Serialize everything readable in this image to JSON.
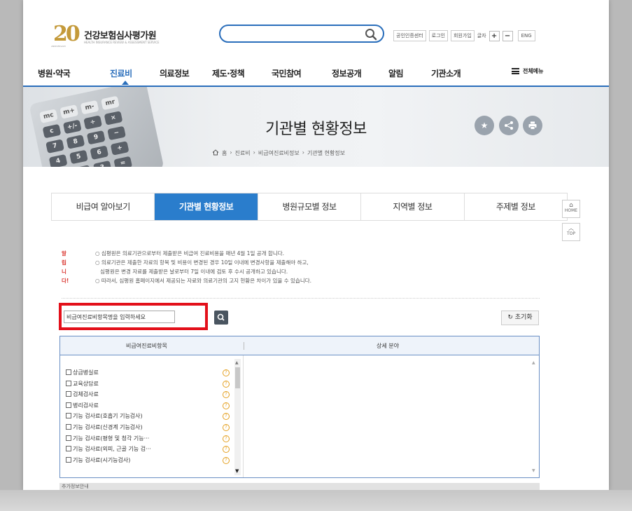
{
  "header": {
    "logo_number": "20",
    "logo_title": "건강보험심사평가원",
    "logo_subtitle": "HEALTH INSURANCE REVIEW & ASSESSMENT SERVICE",
    "logo_small": "ANNIVERSARY",
    "search_placeholder": "",
    "util": {
      "cert_center": "공인인증센터",
      "login": "로그인",
      "join": "회원가입",
      "font_label": "글자",
      "font_plus": "+",
      "font_minus": "−",
      "eng": "ENG"
    }
  },
  "gnb": {
    "items": [
      "병원·약국",
      "진료비",
      "의료정보",
      "제도·정책",
      "국민참여",
      "정보공개",
      "알림",
      "기관소개"
    ],
    "active_index": 1,
    "all_menu": "전체메뉴"
  },
  "banner": {
    "title": "기관별 현황정보",
    "breadcrumb": [
      "홈",
      "진료비",
      "비급여진료비정보",
      "기관별 현황정보"
    ],
    "keys": [
      "mc",
      "m+",
      "m-",
      "mr",
      "c",
      "+/-",
      "÷",
      "×",
      "7",
      "8",
      "9",
      "−",
      "4",
      "5",
      "6",
      "+",
      "1",
      "2",
      "3",
      "="
    ],
    "buttons": {
      "favorite": "★",
      "share": "<",
      "print": "⎙"
    }
  },
  "tabs": [
    {
      "label": "비급여 알아보기",
      "active": false
    },
    {
      "label": "기관별 현황정보",
      "active": true
    },
    {
      "label": "병원규모별 정보",
      "active": false
    },
    {
      "label": "지역별 정보",
      "active": false
    },
    {
      "label": "주제별 정보",
      "active": false
    }
  ],
  "side": {
    "home": "HOME",
    "top": "TOP"
  },
  "notice": {
    "label": "알립니다!",
    "lines": [
      "○ 심평원은 의료기관으로부터 제출받은 비급여 진료비용을 매년 4월 1일 공개 합니다.",
      "○ 의료기관은 제출한 자료의 항목 및 비용이 변경된 경우 10일 이내에 변경사항을 제출해야 하고,",
      "   심평원은 변경 자료를 제출받은 날로부터 7일 이내에 검토 후 수시 공개하고 있습니다.",
      "○ 따라서, 심평원 홈페이지에서 제공되는 자료와 의료기관의 고지 현황은 차이가 있을 수 있습니다."
    ]
  },
  "search": {
    "value": "비급여진료비항목명을 입력하세요",
    "reset_label": "초기화"
  },
  "table": {
    "col1": "비급여진료비항목",
    "col2": "상세 분야",
    "items": [
      "상급병실료",
      "교육상담료",
      "검체검사료",
      "병리검사료",
      "기능 검사료(호흡기 기능검사)",
      "기능 검사료(신경계 기능검사)",
      "기능 검사료(평형 및 청각 기능···",
      "기능 검사료(외피, 근골 기능 검···",
      "기능 검사료(시기능검사)"
    ],
    "info_symbol": "?"
  },
  "bottom": {
    "text": "추가정보안내"
  }
}
